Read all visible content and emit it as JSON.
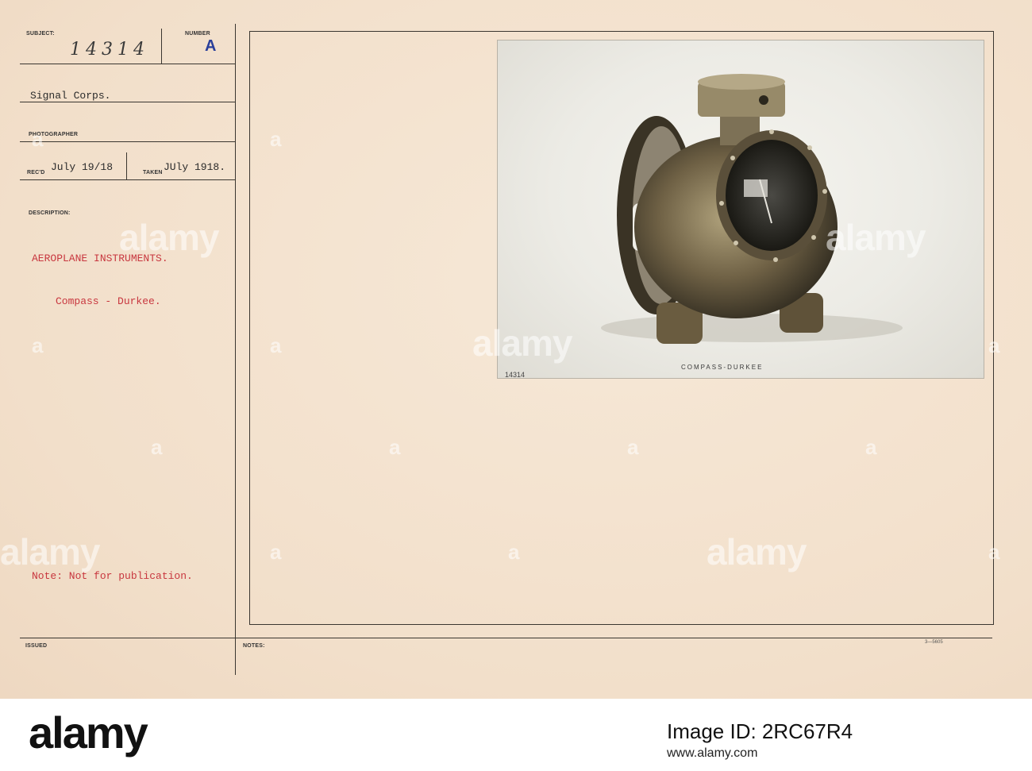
{
  "form": {
    "subject_label": "SUBJECT:",
    "number_label": "NUMBER",
    "subject_handwritten": "14314",
    "number_stamp": "A",
    "unit": "Signal Corps.",
    "photographer_label": "PHOTOGRAPHER",
    "recd_label": "REC'D",
    "recd_value": "July 19/18",
    "taken_label": "TAKEN",
    "taken_value": "JUly 1918.",
    "description_label": "DESCRIPTION:",
    "description_title": "AEROPLANE INSTRUMENTS.",
    "description_item": "Compass - Durkee.",
    "note": "Note: Not for publication.",
    "issued_label": "ISSUED",
    "notes_label": "NOTES:",
    "form_code": "3—5605"
  },
  "photo": {
    "caption": "COMPASS-DURKEE",
    "negative_number": "14314"
  },
  "watermark": {
    "text": "alamy",
    "small_text": "a"
  },
  "footer": {
    "logo": "alamy",
    "image_id": "Image ID: 2RC67R4",
    "website": "www.alamy.com"
  }
}
